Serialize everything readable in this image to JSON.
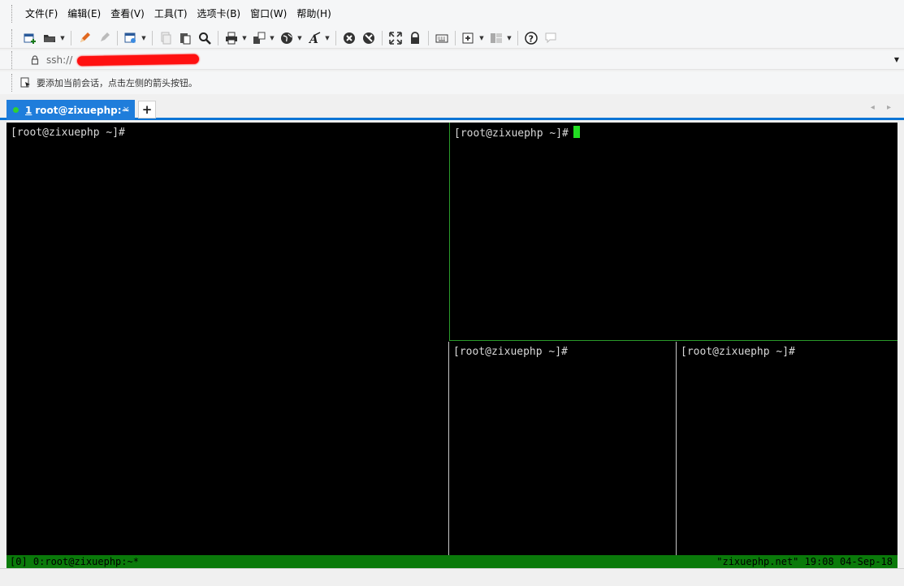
{
  "menu": {
    "items": [
      "文件(F)",
      "编辑(E)",
      "查看(V)",
      "工具(T)",
      "选项卡(B)",
      "窗口(W)",
      "帮助(H)"
    ]
  },
  "toolbar": {
    "icons": [
      "new-session-icon",
      "open-folder-icon",
      "pencil-icon",
      "eraser-icon",
      "properties-icon",
      "copy-icon",
      "paste-icon",
      "find-icon",
      "print-icon",
      "transfer-icon",
      "globe-icon",
      "font-icon",
      "xftp-icon",
      "xshell-icon",
      "fullscreen-icon",
      "lock-icon",
      "keyboard-icon",
      "add-pane-icon",
      "layout-icon",
      "help-icon",
      "chat-icon"
    ]
  },
  "address": {
    "value": "ssh://"
  },
  "hint": {
    "text": "要添加当前会话，点击左侧的箭头按钮。"
  },
  "tabs": [
    {
      "number": "1",
      "label": "root@zixuephp:~",
      "close": "×"
    }
  ],
  "tab_add_label": "+",
  "tab_nav": "◂ ▸",
  "terminal": {
    "panes": [
      {
        "prompt": "[root@zixuephp ~]#"
      },
      {
        "prompt": "[root@zixuephp ~]#"
      },
      {
        "prompt": "[root@zixuephp ~]#"
      },
      {
        "prompt": "[root@zixuephp ~]#"
      }
    ],
    "status_left": "[0] 0:root@zixuephp:~*",
    "status_right": "\"zixuephp.net\" 19:08 04-Sep-18"
  },
  "colors": {
    "tab_active": "#1f7ddb",
    "status_bar": "#0a7a0a",
    "cursor": "#22dd22"
  }
}
